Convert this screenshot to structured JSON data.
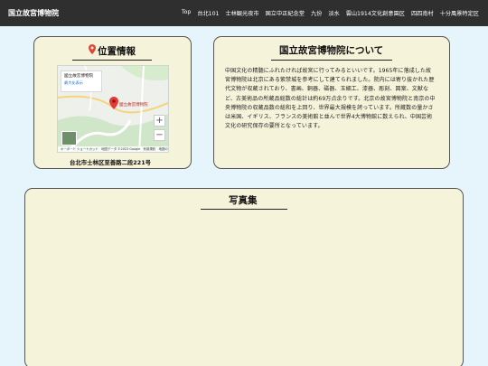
{
  "header": {
    "site_title": "国立故宮博物院",
    "nav": [
      "Top",
      "台北101",
      "士林観光夜市",
      "国立中正紀念堂",
      "九份",
      "淡水",
      "雲山1914文化創意園区",
      "四四南村",
      "十分風景特定区"
    ]
  },
  "location": {
    "title": "位置情報",
    "address": "台北市士林区至善路二段221号",
    "map": {
      "infobox_title": "國立故宮博物院",
      "infobox_link": "最大化表示",
      "marker_label": "國立故宮博物院",
      "zoom_in": "+",
      "zoom_out": "−",
      "footer": "キーボード ショートカット　地図データ ©2023 Google　利用規約　地図の誤りを報告する"
    }
  },
  "about": {
    "title": "国立故宮博物院について",
    "text": "中国文化の精髄にふれたければ故宮に行ってみるといいです。1965年に落成した故宮博物院は北京にある紫禁城を参考にして建てられました。院内には寄り抜かれた歴代文物が収蔵されており、書画、銅器、磁器、玉細工、漆器、彫刻、図案、文献など、古美術品の所蔵品総数の総計は約69万点余りです。北京の故宮博物院と南京の中央博物院の収蔵品数の総和を上回り、世界最大規模を誇っています。所蔵数の量かさは米国、イギリス、フランスの美術館と並んで世界4大博物館に数えられ、中国芸術文化の研究保存の要所となっています。"
  },
  "photos": {
    "title": "写真集"
  },
  "colors": {
    "header_bg": "#2f2f2f",
    "page_bg": "#e6f4fb",
    "card_bg": "#f5f3d9",
    "pin": "#e0453a"
  }
}
